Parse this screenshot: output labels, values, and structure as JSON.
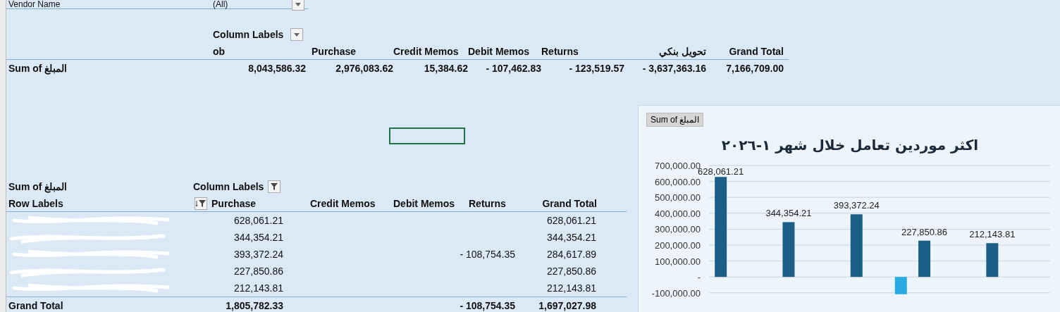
{
  "filter": {
    "label": "Vendor Name",
    "value": "(All)"
  },
  "summary_pivot": {
    "column_labels": "Column Labels",
    "columns": [
      "ob",
      "Purchase",
      "Credit Memos",
      "Debit Memos",
      "Returns",
      "تحويل بنكي",
      "Grand Total"
    ],
    "row_label": "Sum of المبلغ",
    "values": [
      "8,043,586.32",
      "2,976,083.62",
      "15,384.62",
      "- 107,462.83",
      "- 123,519.57",
      "- 3,637,363.16",
      "7,166,709.00"
    ]
  },
  "active_cell": {
    "selected": true
  },
  "detail_pivot": {
    "value_label": "Sum of المبلغ",
    "column_labels": "Column Labels",
    "row_labels": "Row Labels",
    "columns": [
      "Purchase",
      "Credit Memos",
      "Debit Memos",
      "Returns",
      "Grand Total"
    ],
    "rows": [
      {
        "purchase": "628,061.21",
        "grand_total": "628,061.21"
      },
      {
        "purchase": "344,354.21",
        "grand_total": "344,354.21"
      },
      {
        "purchase": "393,372.24",
        "returns": "- 108,754.35",
        "grand_total": "284,617.89"
      },
      {
        "purchase": "227,850.86",
        "grand_total": "227,850.86"
      },
      {
        "purchase": "212,143.81",
        "grand_total": "212,143.81"
      }
    ],
    "total": {
      "label": "Grand Total",
      "purchase": "1,805,782.33",
      "returns": "- 108,754.35",
      "grand_total": "1,697,027.98"
    }
  },
  "chart": {
    "field_button": "Sum of المبلغ",
    "chart_data": {
      "type": "bar",
      "title": "اكثر موردين تعامل خلال شهر ١-٢٠٢٦",
      "ylim": [
        -110000,
        700000
      ],
      "grid": true,
      "yticks": [
        {
          "value": 700000,
          "label": "700,000.00"
        },
        {
          "value": 600000,
          "label": "600,000.00"
        },
        {
          "value": 500000,
          "label": "500,000.00"
        },
        {
          "value": 400000,
          "label": "400,000.00"
        },
        {
          "value": 300000,
          "label": "300,000.00"
        },
        {
          "value": 200000,
          "label": "200,000.00"
        },
        {
          "value": 100000,
          "label": "100,000.00"
        },
        {
          "value": 0,
          "label": "-"
        },
        {
          "value": -100000,
          "label": "-100,000.00"
        }
      ],
      "series": [
        {
          "color": "#1c5f86",
          "values": [
            628061.21,
            344354.21,
            393372.24,
            227850.86,
            212143.81
          ],
          "value_labels": [
            "628,061.21",
            "344,354.21",
            "393,372.24",
            "227,850.86",
            "212,143.81"
          ]
        },
        {
          "color": "#29abe2",
          "values": [
            null,
            null,
            -108754.35,
            null,
            null
          ]
        }
      ]
    }
  }
}
